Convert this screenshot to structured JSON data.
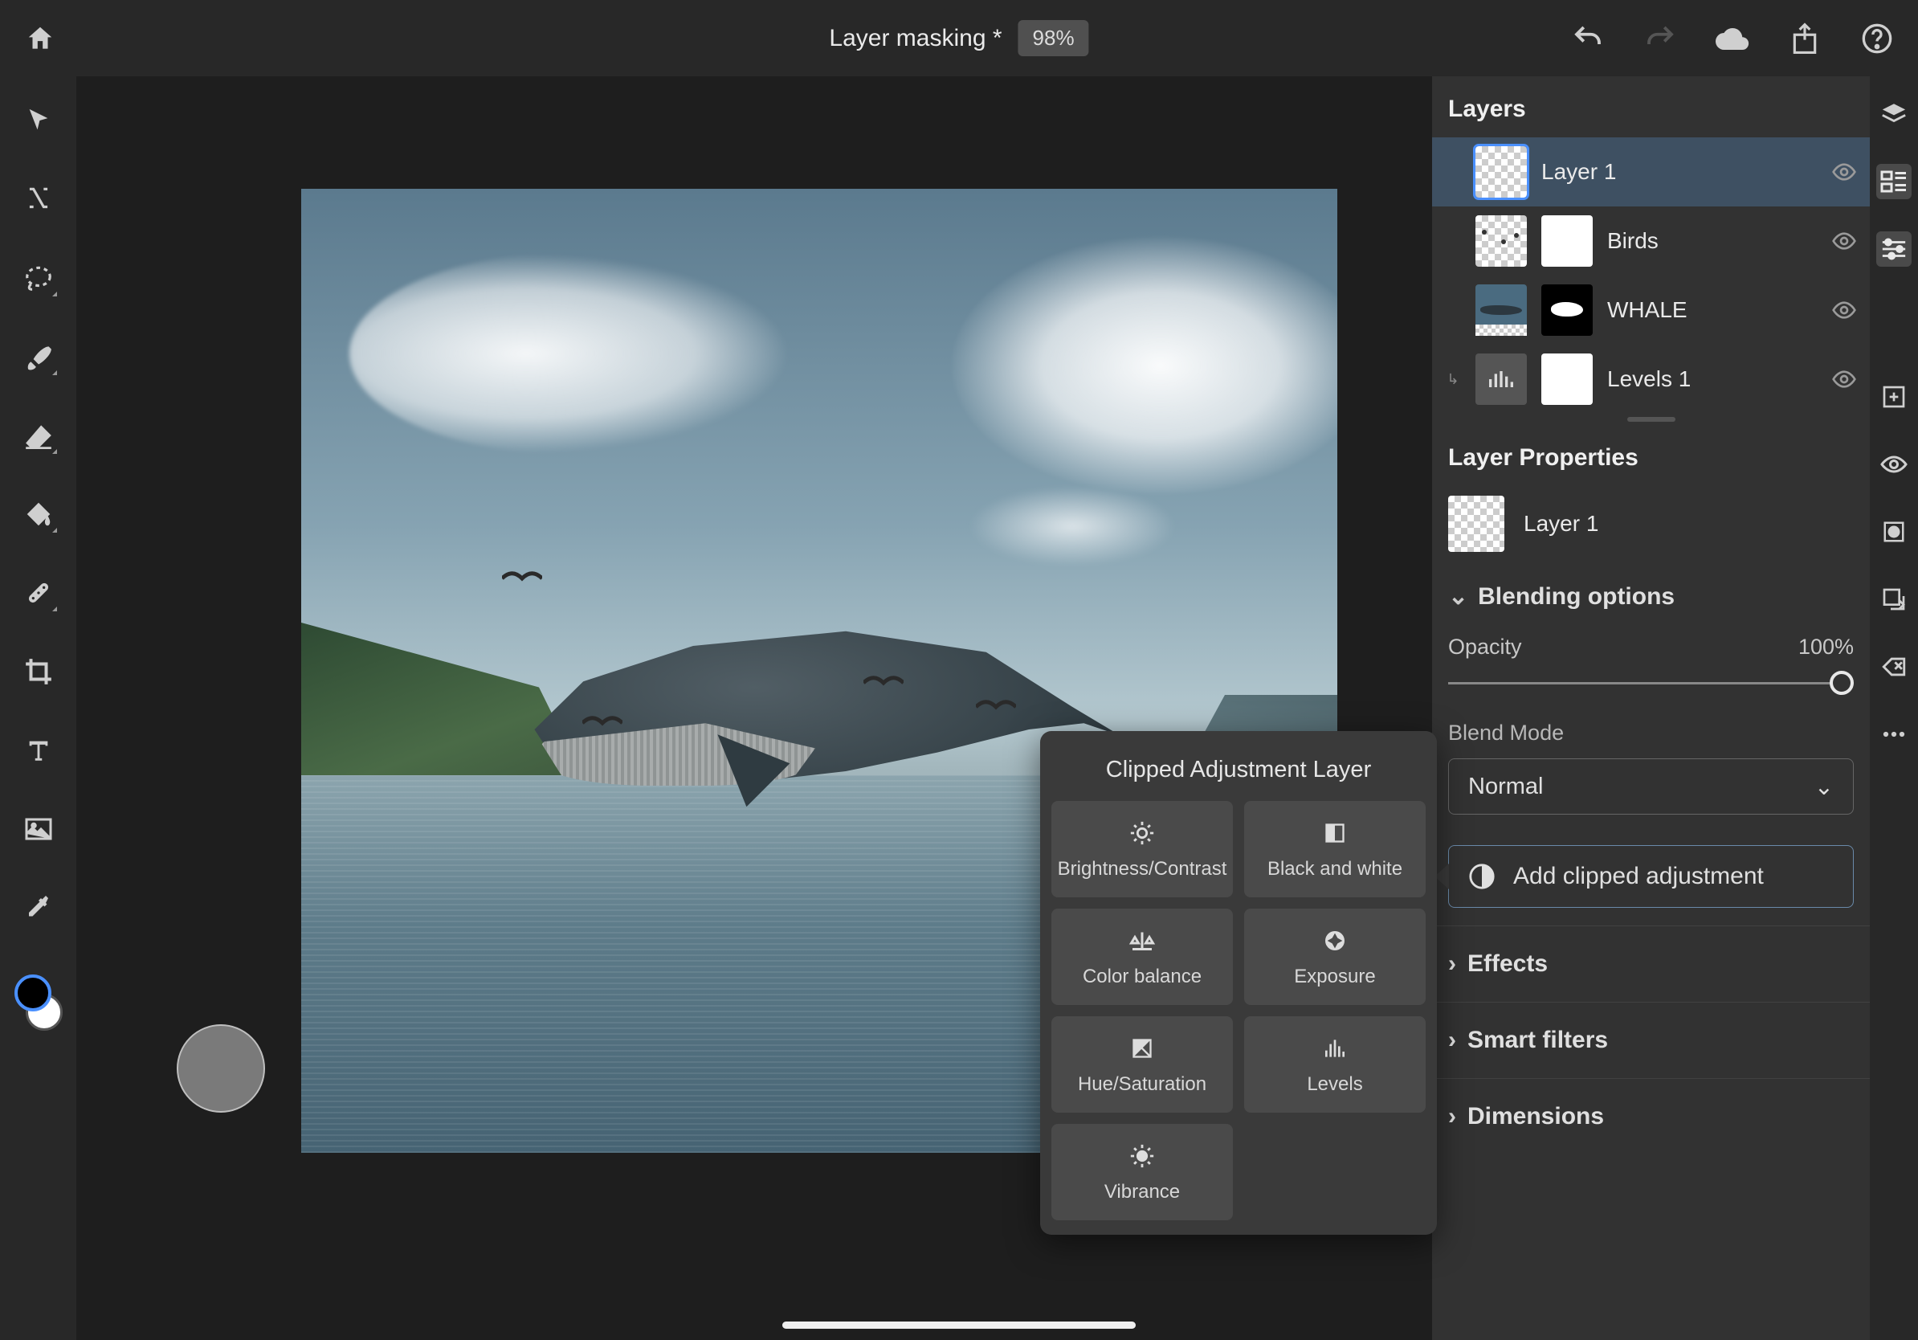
{
  "header": {
    "document_title": "Layer masking *",
    "zoom": "98%"
  },
  "tools": {
    "home": "home-icon",
    "items": [
      "move",
      "transform",
      "lasso",
      "brush",
      "eraser",
      "fill",
      "heal",
      "crop",
      "type",
      "place",
      "eyedropper"
    ]
  },
  "layers_panel": {
    "title": "Layers",
    "layers": [
      {
        "name": "Layer 1",
        "selected": true,
        "has_mask": false
      },
      {
        "name": "Birds",
        "selected": false,
        "has_mask": true
      },
      {
        "name": "WHALE",
        "selected": false,
        "has_mask": true
      },
      {
        "name": "Levels 1",
        "selected": false,
        "has_mask": true,
        "clipped": true,
        "adjust": true
      }
    ]
  },
  "properties": {
    "title": "Layer Properties",
    "layer_name": "Layer 1",
    "blending_header": "Blending options",
    "opacity_label": "Opacity",
    "opacity_value": "100%",
    "blend_mode_label": "Blend Mode",
    "blend_mode_value": "Normal",
    "clipped_button": "Add clipped adjustment",
    "sections": {
      "effects": "Effects",
      "smart_filters": "Smart filters",
      "dimensions": "Dimensions"
    }
  },
  "popover": {
    "title": "Clipped Adjustment Layer",
    "items": [
      {
        "label": "Brightness/Contrast",
        "icon": "brightness"
      },
      {
        "label": "Black and white",
        "icon": "bw"
      },
      {
        "label": "Color balance",
        "icon": "balance"
      },
      {
        "label": "Exposure",
        "icon": "exposure"
      },
      {
        "label": "Hue/Saturation",
        "icon": "huesat"
      },
      {
        "label": "Levels",
        "icon": "levels"
      },
      {
        "label": "Vibrance",
        "icon": "vibrance"
      }
    ]
  }
}
